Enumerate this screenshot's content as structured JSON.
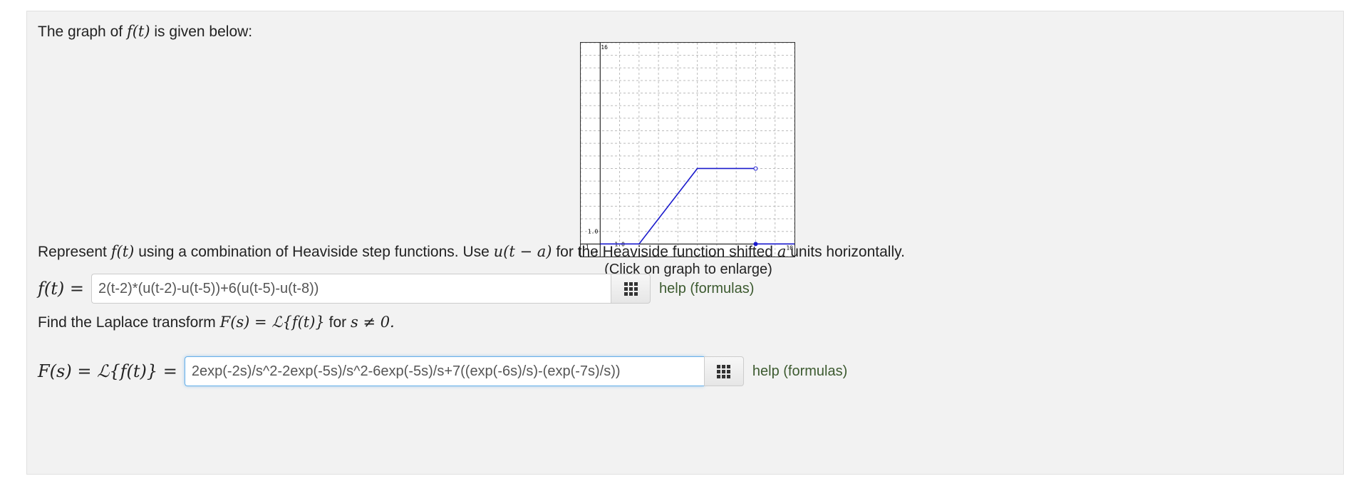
{
  "intro": {
    "prefix": "The graph of",
    "func": "f(t)",
    "suffix": "is given below:"
  },
  "graph": {
    "caption": "(Click on graph to enlarge)",
    "tick_labels": {
      "y_top": "16",
      "y_one": "1.0",
      "x_left": "-1",
      "y_bottom": "-1",
      "x_one": "1.0",
      "x_right": "10"
    }
  },
  "chart_data": {
    "type": "line",
    "xlim": [
      -1,
      10
    ],
    "ylim": [
      -1,
      16
    ],
    "grid": true,
    "series": [
      {
        "x": [
          0,
          2,
          5,
          8
        ],
        "y": [
          0,
          0,
          6,
          6
        ]
      },
      {
        "x": [
          8,
          10
        ],
        "y": [
          0,
          0
        ]
      }
    ],
    "points": [
      {
        "x": 8,
        "y": 6,
        "style": "open"
      },
      {
        "x": 8,
        "y": 0,
        "style": "filled"
      }
    ]
  },
  "instruction": {
    "text1": "Represent",
    "func": "f(t)",
    "text2": "using a combination of Heaviside step functions. Use",
    "ufunc": "u(t − a)",
    "text3": "for the Heaviside function shifted",
    "avar": "a",
    "text4": "units horizontally."
  },
  "answer1": {
    "lhs": "f(t) =",
    "value": "2(t-2)*(u(t-2)-u(t-5))+6(u(t-5)-u(t-8))",
    "help": "help (formulas)"
  },
  "laplace_prompt": {
    "text1": "Find the Laplace transform",
    "expr": "F(s) = ℒ{f(t)}",
    "text2": "for",
    "cond": "s ≠ 0.",
    "text3": ""
  },
  "answer2": {
    "lhs": "F(s) = ℒ{f(t)} =",
    "value": "2exp(-2s)/s^2-2exp(-5s)/s^2-6exp(-5s)/s+7((exp(-6s)/s)-(exp(-7s)/s))",
    "help": "help (formulas)"
  },
  "colors": {
    "curve": "#1a1acc",
    "grid": "#bbbbbb",
    "help_link": "#3c5a2f",
    "focus_border": "#66afe9"
  }
}
